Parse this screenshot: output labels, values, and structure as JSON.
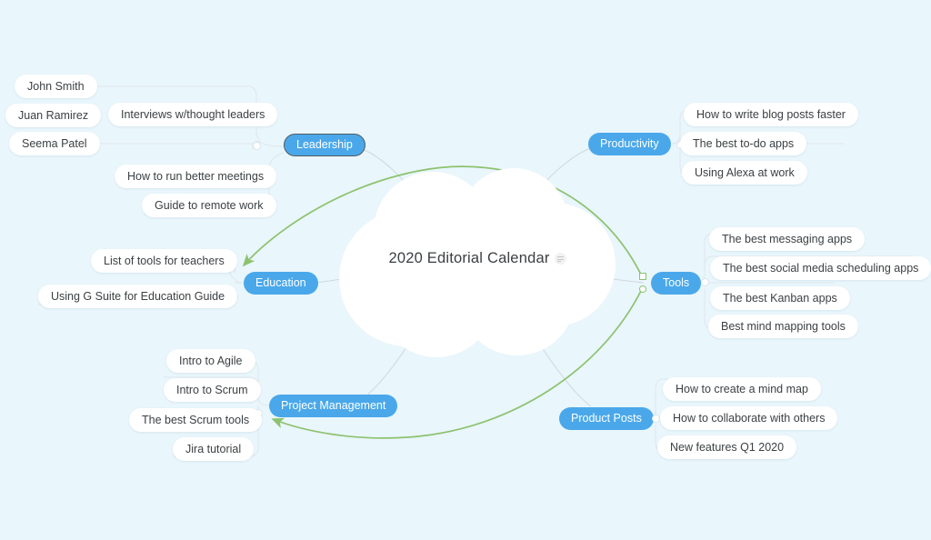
{
  "canvas": {
    "background": "#e9f6fc",
    "accent_blue": "#4aa8ea",
    "relation_green": "#8dc26f",
    "branch_line": "#cfd8dd",
    "card_background": "#ffffff",
    "text_color": "#3c4043"
  },
  "center": {
    "title": "2020 Editorial Calendar",
    "note_icon": "note-lines-icon",
    "selected": false
  },
  "branches": [
    {
      "id": "leadership",
      "label": "Leadership",
      "selected": true,
      "side": "left",
      "children": [
        "John Smith",
        "Juan Ramirez",
        "Seema Patel",
        "Interviews w/thought leaders",
        "How to run better meetings",
        "Guide to remote work"
      ]
    },
    {
      "id": "education",
      "label": "Education",
      "selected": false,
      "side": "left",
      "children": [
        "List of tools for teachers",
        "Using G Suite for Education Guide"
      ]
    },
    {
      "id": "project-management",
      "label": "Project Management",
      "selected": false,
      "side": "left",
      "children": [
        "Intro to Agile",
        "Intro to Scrum",
        "The best Scrum tools",
        "Jira tutorial"
      ]
    },
    {
      "id": "productivity",
      "label": "Productivity",
      "selected": false,
      "side": "right",
      "children": [
        "How to write blog posts faster",
        "The best to-do apps",
        "Using Alexa at work"
      ]
    },
    {
      "id": "tools",
      "label": "Tools",
      "selected": false,
      "side": "right",
      "children": [
        "The best messaging apps",
        "The best social media scheduling apps",
        "The best Kanban apps",
        "Best mind mapping tools"
      ]
    },
    {
      "id": "product-posts",
      "label": "Product Posts",
      "selected": false,
      "side": "right",
      "children": [
        "How to create a mind map",
        "How to collaborate with others",
        "New features Q1 2020"
      ]
    }
  ],
  "relationships": [
    {
      "id": "tools-to-education",
      "from": "tools",
      "to": "education",
      "color": "#8dc26f"
    },
    {
      "id": "tools-to-scrum-tools",
      "from": "tools",
      "to": "The best Scrum tools",
      "color": "#8dc26f"
    }
  ]
}
